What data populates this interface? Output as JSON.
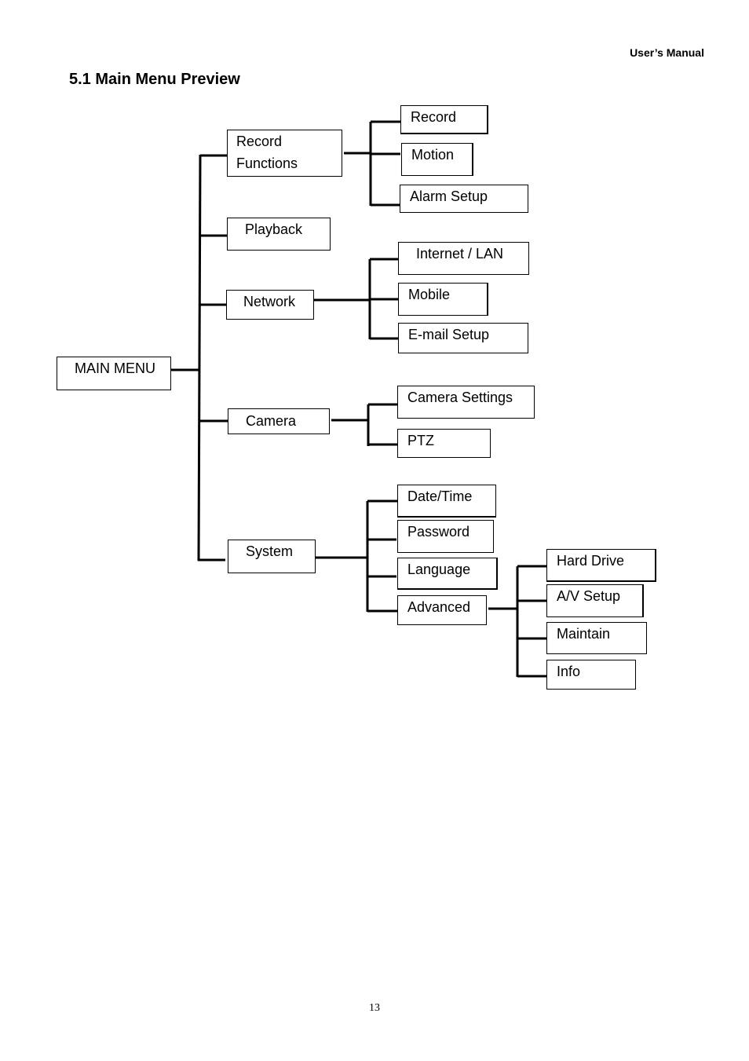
{
  "header": {
    "text": "User’s Manual"
  },
  "title": "5.1 Main Menu Preview",
  "page_number": "13",
  "tree": {
    "root": "MAIN MENU",
    "record_functions": {
      "label_line1": "Record",
      "label_line2": "Functions",
      "children": [
        "Record",
        "Motion",
        "Alarm Setup"
      ]
    },
    "playback": {
      "label": "Playback"
    },
    "network": {
      "label": "Network",
      "children": [
        "Internet / LAN",
        "Mobile",
        "E-mail Setup"
      ]
    },
    "camera": {
      "label": "Camera",
      "children": [
        "Camera Settings",
        "PTZ"
      ]
    },
    "system": {
      "label": "System",
      "children": [
        "Date/Time",
        "Password",
        "Language",
        "Advanced"
      ]
    },
    "advanced": {
      "label": "Advanced",
      "children": [
        "Hard Drive",
        "A/V Setup",
        "Maintain",
        "Info"
      ]
    }
  }
}
